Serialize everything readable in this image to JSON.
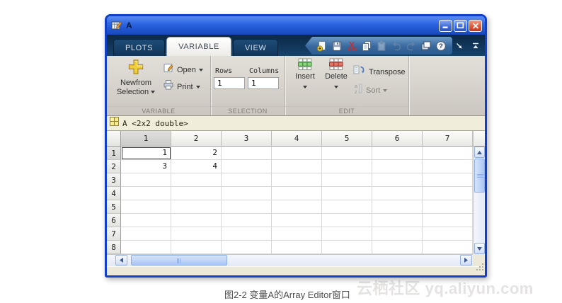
{
  "window": {
    "title": "A"
  },
  "tabs": [
    {
      "label": "PLOTS",
      "active": false
    },
    {
      "label": "VARIABLE",
      "active": true
    },
    {
      "label": "VIEW",
      "active": false
    }
  ],
  "quick_toolbar": {
    "icons": [
      {
        "name": "new-variable",
        "disabled": false
      },
      {
        "name": "save",
        "disabled": false
      },
      {
        "name": "cut",
        "disabled": false
      },
      {
        "name": "copy",
        "disabled": false
      },
      {
        "name": "paste",
        "disabled": true
      },
      {
        "name": "undo",
        "disabled": true
      },
      {
        "name": "redo",
        "disabled": true
      },
      {
        "name": "switch-windows",
        "disabled": false
      },
      {
        "name": "help",
        "disabled": false
      }
    ],
    "right_icons": [
      {
        "name": "undock",
        "disabled": false
      },
      {
        "name": "minimize-ribbon",
        "disabled": false
      }
    ]
  },
  "ribbon": {
    "variable_group": {
      "label": "VARIABLE",
      "new_from_selection_line1": "Newfrom",
      "new_from_selection_line2": "Selection",
      "open_label": "Open",
      "print_label": "Print"
    },
    "selection_group": {
      "label": "SELECTION",
      "rows_label": "Rows",
      "rows_value": "1",
      "columns_label": "Columns",
      "columns_value": "1"
    },
    "edit_group": {
      "label": "EDIT",
      "insert_label": "Insert",
      "delete_label": "Delete",
      "transpose_label": "Transpose",
      "sort_label": "Sort"
    }
  },
  "document_tab": {
    "label": "A <2x2 double>"
  },
  "table": {
    "column_headers": [
      "1",
      "2",
      "3",
      "4",
      "5",
      "6",
      "7"
    ],
    "row_headers": [
      "1",
      "2",
      "3",
      "4",
      "5",
      "6",
      "7",
      "8"
    ],
    "cells": [
      [
        "1",
        "2"
      ],
      [
        "3",
        "4"
      ]
    ],
    "selected": {
      "row": 1,
      "col": 1
    }
  },
  "caption": "图2-2 变量A的Array Editor窗口",
  "watermark": "云栖社区 yq.aliyun.com"
}
